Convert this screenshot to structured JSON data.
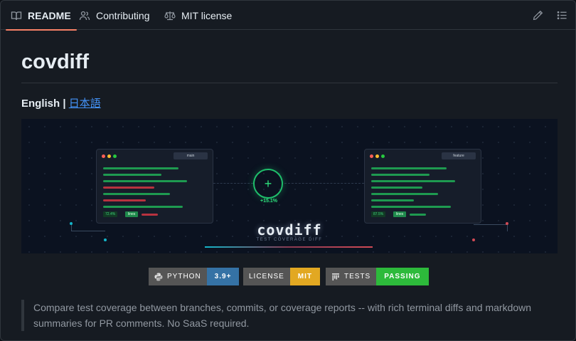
{
  "tabs": [
    {
      "label": "README",
      "icon": "book-icon",
      "active": true
    },
    {
      "label": "Contributing",
      "icon": "people-icon",
      "active": false
    },
    {
      "label": "MIT license",
      "icon": "law-icon",
      "active": false
    }
  ],
  "toolbar": {
    "edit_icon": "pencil-icon",
    "toc_icon": "list-unordered-icon"
  },
  "readme": {
    "title": "covdiff",
    "lang_current": "English",
    "lang_sep": "|",
    "lang_alt": "日本語",
    "banner": {
      "left_branch": "main",
      "right_branch": "feature",
      "left_pct": "72.4%",
      "right_pct": "87.5%",
      "lines_tag": "lines",
      "delta": "+15.1%",
      "plus": "+",
      "wordmark": "covdiff",
      "tagline": "TEST COVERAGE DIFF"
    },
    "badges": [
      {
        "label": "PYTHON",
        "value": "3.9+",
        "icon": "python-icon",
        "color": "#3572a5"
      },
      {
        "label": "LICENSE",
        "value": "MIT",
        "icon": "",
        "color": "#e2a822"
      },
      {
        "label": "TESTS",
        "value": "PASSING",
        "icon": "pytest-icon",
        "color": "#2dba3b"
      }
    ],
    "description": "Compare test coverage between branches, commits, or coverage reports -- with rich terminal diffs and markdown summaries for PR comments. No SaaS required."
  },
  "colors": {
    "accent_tab": "#f78166",
    "link": "#4493f8",
    "green": "#1fbf6b",
    "red": "#d14a55"
  }
}
